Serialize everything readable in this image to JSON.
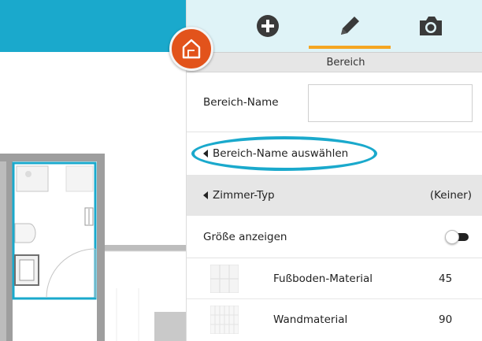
{
  "floorplan": {
    "house_button_icon": "house-icon"
  },
  "toolbar": {
    "add_icon": "plus-circle-icon",
    "edit_icon": "pencil-icon",
    "camera_icon": "camera-icon",
    "active_color": "#f5a623"
  },
  "panel": {
    "section_title": "Bereich",
    "name_label": "Bereich-Name",
    "name_value": "",
    "select_name_label": "Bereich-Name auswählen",
    "room_type_label": "Zimmer-Typ",
    "room_type_value": "(Keiner)",
    "show_size_label": "Größe anzeigen",
    "show_size_on": true,
    "materials": [
      {
        "label": "Fußboden-Material",
        "value": "45",
        "icon": "tile-grid-icon"
      },
      {
        "label": "Wandmaterial",
        "value": "90",
        "icon": "wall-grid-icon"
      }
    ]
  },
  "colors": {
    "accent": "#1aa9cc",
    "house_button": "#e2531b",
    "highlight": "#1aa9cc"
  }
}
